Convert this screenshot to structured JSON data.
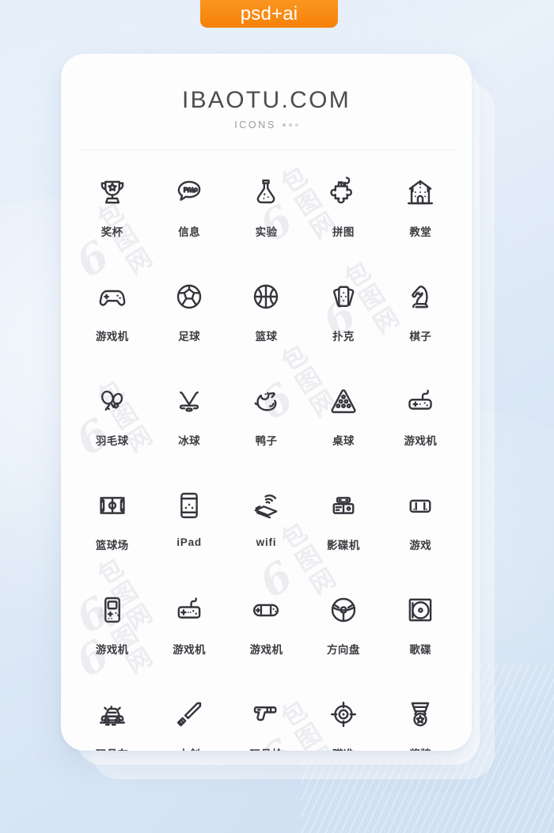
{
  "badge": {
    "label": "psd+ai",
    "color": "#f7880a"
  },
  "header": {
    "title": "IBAOTU.COM",
    "subtitle": "ICONS",
    "dot_count": 3
  },
  "watermark": {
    "mark": "6",
    "text": "包图网",
    "repeat": 9
  },
  "grid": {
    "columns": 5,
    "rows": 6,
    "items": [
      {
        "icon": "trophy-icon",
        "label": "奖杯",
        "latin": false
      },
      {
        "icon": "message-play-icon",
        "label": "信息",
        "latin": false
      },
      {
        "icon": "flask-icon",
        "label": "实验",
        "latin": false
      },
      {
        "icon": "puzzle-icon",
        "label": "拼图",
        "latin": false
      },
      {
        "icon": "castle-icon",
        "label": "教堂",
        "latin": false
      },
      {
        "icon": "gamepad-icon",
        "label": "游戏机",
        "latin": false
      },
      {
        "icon": "soccer-ball-icon",
        "label": "足球",
        "latin": false
      },
      {
        "icon": "basketball-icon",
        "label": "篮球",
        "latin": false
      },
      {
        "icon": "playing-cards-icon",
        "label": "扑克",
        "latin": false
      },
      {
        "icon": "chess-knight-icon",
        "label": "棋子",
        "latin": false
      },
      {
        "icon": "badminton-icon",
        "label": "羽毛球",
        "latin": false
      },
      {
        "icon": "hockey-sticks-icon",
        "label": "冰球",
        "latin": false
      },
      {
        "icon": "duck-icon",
        "label": "鸭子",
        "latin": false
      },
      {
        "icon": "billiards-rack-icon",
        "label": "桌球",
        "latin": false
      },
      {
        "icon": "retro-gamepad-icon",
        "label": "游戏机",
        "latin": false
      },
      {
        "icon": "basketball-court-icon",
        "label": "篮球场",
        "latin": false
      },
      {
        "icon": "tablet-icon",
        "label": "iPad",
        "latin": true
      },
      {
        "icon": "wifi-icon",
        "label": "wifi",
        "latin": true
      },
      {
        "icon": "dvd-player-icon",
        "label": "影碟机",
        "latin": false
      },
      {
        "icon": "game-controller-icon",
        "label": "游戏",
        "latin": false
      },
      {
        "icon": "handheld-console-icon",
        "label": "游戏机",
        "latin": false
      },
      {
        "icon": "nes-gamepad-icon",
        "label": "游戏机",
        "latin": false
      },
      {
        "icon": "psp-console-icon",
        "label": "游戏机",
        "latin": false
      },
      {
        "icon": "steering-wheel-icon",
        "label": "方向盘",
        "latin": false
      },
      {
        "icon": "cd-disc-icon",
        "label": "歌碟",
        "latin": false
      },
      {
        "icon": "toy-car-icon",
        "label": "玩具车",
        "latin": false
      },
      {
        "icon": "wooden-sword-icon",
        "label": "木剑",
        "latin": false
      },
      {
        "icon": "toy-gun-icon",
        "label": "玩具枪",
        "latin": false
      },
      {
        "icon": "crosshair-icon",
        "label": "瞄准",
        "latin": false
      },
      {
        "icon": "medal-icon",
        "label": "奖牌",
        "latin": false
      }
    ]
  },
  "style": {
    "icon_stroke": "#35353c",
    "label_color": "#3c3c41",
    "card_bg": "#fdfdfe"
  }
}
